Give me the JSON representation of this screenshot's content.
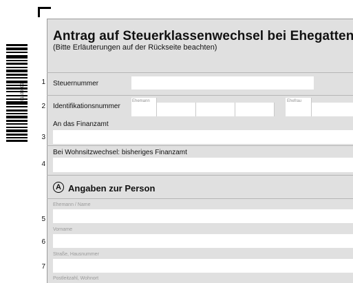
{
  "form": {
    "title": "Antrag auf Steuerklassenwechsel bei Ehegatten",
    "subtitle": "(Bitte Erläuterungen auf der Rückseite beachten)",
    "barcode_number": "2011006001"
  },
  "rows": [
    {
      "number": "1",
      "label": "Steuernummer",
      "value": ""
    },
    {
      "number": "2",
      "label": "Identifikationsnummer",
      "husband_label": "Ehemann",
      "wife_label": "Ehefrau"
    },
    {
      "number": "3",
      "label": "An das Finanzamt",
      "value": ""
    },
    {
      "number": "4",
      "label": "Bei Wohnsitzwechsel: bisheriges Finanzamt",
      "value": ""
    }
  ],
  "section_a": {
    "letter": "A",
    "title": "Angaben zur Person",
    "fields": [
      {
        "number": "5",
        "label": "Ehemann / Name",
        "value": ""
      },
      {
        "number": "6",
        "label": "Vorname",
        "value": ""
      },
      {
        "number": "7",
        "label": "Straße, Hausnummer",
        "value": ""
      },
      {
        "number": "",
        "label": "Postleitzahl, Wohnort",
        "value": ""
      }
    ]
  }
}
